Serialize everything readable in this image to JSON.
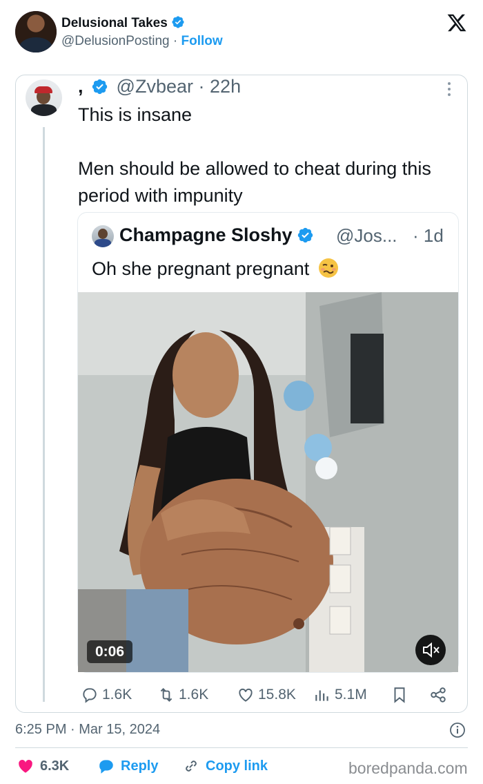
{
  "author": {
    "name": "Delusional Takes",
    "handle": "@DelusionPosting",
    "separator": "·",
    "follow_label": "Follow"
  },
  "quoted_tweet": {
    "name": ",",
    "handle": "@Zvbear",
    "time": "22h",
    "text_line1": "This is insane",
    "text_line2": "Men should be allowed to cheat during this period with impunity",
    "nested": {
      "name": "Champagne Sloshy",
      "handle": "@Jos...",
      "time": "· 1d",
      "text": "Oh she pregnant pregnant",
      "video_time": "0:06"
    },
    "actions": {
      "replies": "1.6K",
      "retweets": "1.6K",
      "likes": "15.8K",
      "views": "5.1M"
    }
  },
  "timestamp": "6:25 PM · Mar 15, 2024",
  "footer": {
    "likes": "6.3K",
    "reply_label": "Reply",
    "copy_label": "Copy link"
  },
  "watermark": "boredpanda.com",
  "icons": {
    "verified": "verified-badge-icon",
    "x_logo": "x-logo-icon",
    "more": "more-dots-icon",
    "reply": "reply-icon",
    "retweet": "retweet-icon",
    "like": "heart-icon",
    "views": "views-icon",
    "bookmark": "bookmark-icon",
    "share": "share-icon",
    "mute": "mute-icon",
    "info": "info-icon",
    "link": "link-icon"
  },
  "colors": {
    "accent": "#1d9bf0",
    "like": "#f91880",
    "text": "#0f1419",
    "secondary": "#536471",
    "border": "#cfd9de"
  }
}
